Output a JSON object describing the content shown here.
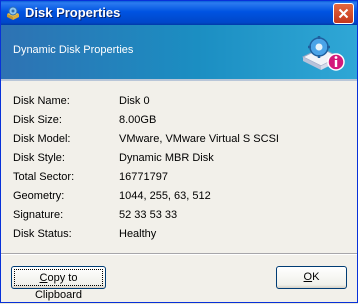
{
  "window": {
    "title": "Disk Properties",
    "close_label": "Close"
  },
  "banner": {
    "title": "Dynamic Disk Properties"
  },
  "properties": [
    {
      "label": "Disk Name:",
      "value": "Disk 0"
    },
    {
      "label": "Disk Size:",
      "value": "8.00GB"
    },
    {
      "label": "Disk Model:",
      "value": "VMware, VMware Virtual S SCSI"
    },
    {
      "label": "Disk Style:",
      "value": "Dynamic MBR Disk"
    },
    {
      "label": "Total Sector:",
      "value": "16771797"
    },
    {
      "label": "Geometry:",
      "value": "1044, 255, 63, 512"
    },
    {
      "label": "Signature:",
      "value": "52 33 53 33"
    },
    {
      "label": "Disk Status:",
      "value": "Healthy"
    }
  ],
  "buttons": {
    "copy_label": "Copy to Clipboard",
    "ok_label": "OK"
  },
  "colors": {
    "titlebar": "#0053e1",
    "banner": "#1b8ec2",
    "dialog_bg": "#f2f0ea"
  },
  "icons": {
    "title": "disk-gear-icon",
    "banner": "disk-gear-info-icon"
  }
}
